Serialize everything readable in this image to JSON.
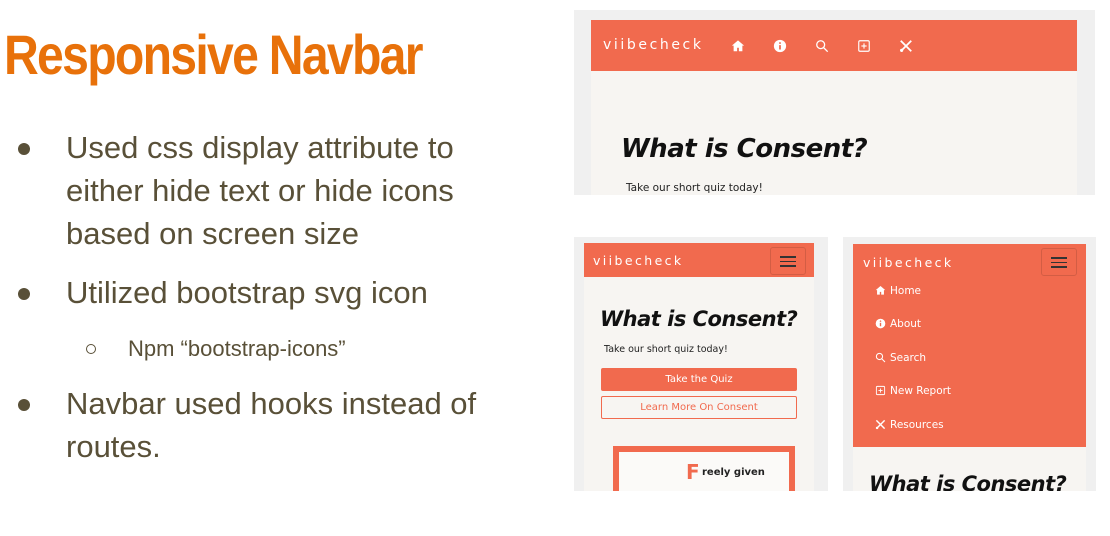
{
  "slide": {
    "title": "Responsive Navbar",
    "bullets": [
      "Used css display attribute to either hide text or hide icons based on screen size",
      "Utilized bootstrap svg icon",
      "Navbar used hooks instead of routes."
    ],
    "sub_bullet": "Npm “bootstrap-icons”"
  },
  "app": {
    "brand": "viibecheck",
    "heading": "What is Consent?",
    "subtext": "Take our short quiz today!",
    "primary_button": "Take the Quiz",
    "secondary_button": "Learn More On Consent",
    "card_letter": "F",
    "card_text": "reely given",
    "menu": [
      "Home",
      "About",
      "Search",
      "New Report",
      "Resources"
    ]
  },
  "colors": {
    "title": "#e8710a",
    "body_text": "#595038",
    "nav_bg": "#f16a4e",
    "page_bg": "#f7f5f2"
  },
  "icons": [
    "house-icon",
    "info-circle-icon",
    "search-icon",
    "plus-square-icon",
    "tools-icon",
    "hamburger-icon"
  ]
}
